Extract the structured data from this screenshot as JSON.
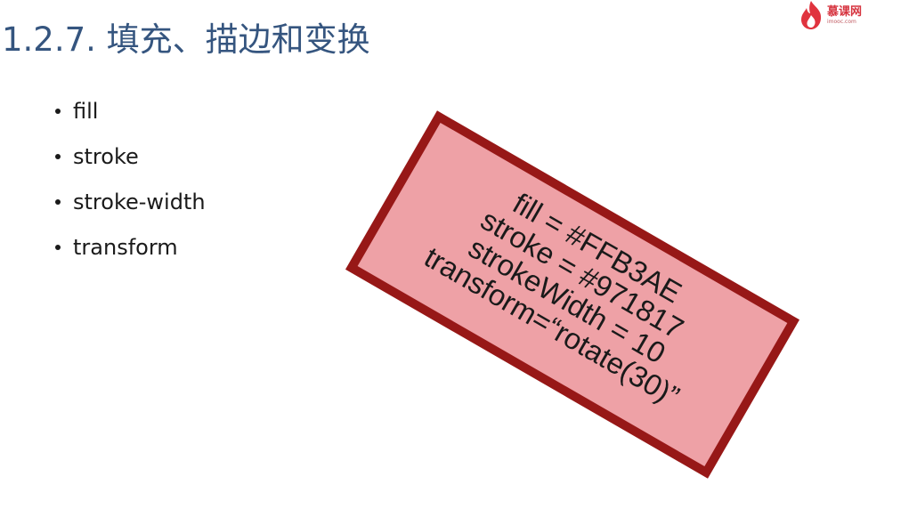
{
  "slide": {
    "title": "1.2.7. 填充、描边和变换",
    "logo_text": "慕课网",
    "logo_subtext": "imooc.com",
    "bullets": [
      "fill",
      "stroke",
      "stroke-width",
      "transform"
    ],
    "example_box": {
      "lines": [
        "fill = #FFB3AE",
        "stroke = #971817",
        "strokeWidth = 10",
        "transform=“rotate(30)”"
      ],
      "fill_color": "#FFB3AE",
      "stroke_color": "#971817",
      "rotation_deg": 30
    },
    "colors": {
      "title": "#35557f",
      "logo": "#d6343f"
    }
  }
}
